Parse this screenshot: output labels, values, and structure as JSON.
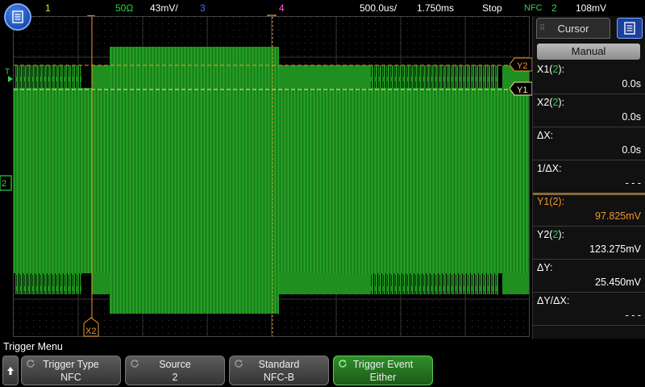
{
  "status": {
    "ch1_label": "1",
    "ch2_impedance": "50Ω",
    "ch2_scale": "43mV/",
    "ch3_label": "3",
    "ch4_label": "4",
    "timebase": "500.0us/",
    "delay": "1.750ms",
    "run_state": "Stop",
    "trigger_type": "NFC",
    "trigger_source": "2",
    "trigger_level": "108mV"
  },
  "colors": {
    "ch1": "#e6e62c",
    "ch2": "#29d44b",
    "ch3": "#4f6cff",
    "ch4": "#ff5adc",
    "cursor": "#f0962c",
    "trace": "#1f8f1f"
  },
  "cursor_panel": {
    "title": "Cursor",
    "mode_button": "Manual",
    "rows": [
      {
        "label_prefix": "X1(",
        "channel": "2",
        "label_suffix": "):",
        "value": "0.0s"
      },
      {
        "label_prefix": "X2(",
        "channel": "2",
        "label_suffix": "):",
        "value": "0.0s"
      },
      {
        "label_prefix": "ΔX:",
        "channel": "",
        "label_suffix": "",
        "value": "0.0s"
      },
      {
        "label_prefix": "1/ΔX:",
        "channel": "",
        "label_suffix": "",
        "value": "- - -"
      },
      {
        "label_prefix": "Y1(",
        "channel": "2",
        "label_suffix": "):",
        "value": "97.825mV"
      },
      {
        "label_prefix": "Y2(",
        "channel": "2",
        "label_suffix": "):",
        "value": "123.275mV"
      },
      {
        "label_prefix": "ΔY:",
        "channel": "",
        "label_suffix": "",
        "value": "25.450mV"
      },
      {
        "label_prefix": "ΔY/ΔX:",
        "channel": "",
        "label_suffix": "",
        "value": "- - -"
      }
    ]
  },
  "markers": {
    "y1": "Y1",
    "y2": "Y2",
    "x2": "X2",
    "ch2_ground": "2",
    "trigger_marker": "T"
  },
  "menu": {
    "title": "Trigger Menu",
    "softkeys": [
      {
        "title": "Trigger Type",
        "value": "NFC"
      },
      {
        "title": "Source",
        "value": "2"
      },
      {
        "title": "Standard",
        "value": "NFC-B"
      },
      {
        "title": "Trigger Event",
        "value": "Either"
      }
    ]
  }
}
